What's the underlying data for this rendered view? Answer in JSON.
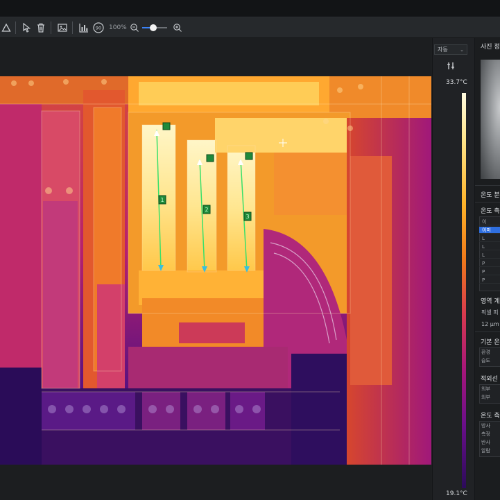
{
  "toolbar": {
    "zoom_label": "100%",
    "zoom_level_fraction": 0.45,
    "icons": [
      "triangle-tool-icon",
      "pointer-select-icon",
      "delete-icon",
      "image-icon",
      "chart-icon",
      "rotate-90-icon",
      "zoom-out-icon",
      "zoom-in-icon"
    ]
  },
  "thermal_image": {
    "markers": [
      "1",
      "2",
      "3"
    ]
  },
  "scale": {
    "mode_select": "자동",
    "max_temp": "33.7°C",
    "min_temp": "19.1°C"
  },
  "side_panel": {
    "photo_title": "사진 정",
    "temp_dist_title": "온도 분",
    "temp_measure_title": "온도 측",
    "measure_rows": [
      "이",
      "이미",
      "L",
      "L",
      "L",
      "P",
      "P",
      "P"
    ],
    "area_title": "영역 계",
    "area_label": "픽셀 피",
    "area_value": "12 μm",
    "basic_title": "기본 온",
    "basic_rows": [
      "환경",
      "습도"
    ],
    "ir_title": "적외선",
    "ir_rows": [
      "외부",
      "외부"
    ],
    "temp_meas2_title": "온도 측",
    "temp_meas2_rows": [
      "방사",
      "측정",
      "반사",
      "알람"
    ]
  },
  "colors": {
    "accent": "#3b82f6",
    "toolbar_bg": "#26292c",
    "panel_bg": "#1b1d1f",
    "marker_line": "#38e06a"
  }
}
